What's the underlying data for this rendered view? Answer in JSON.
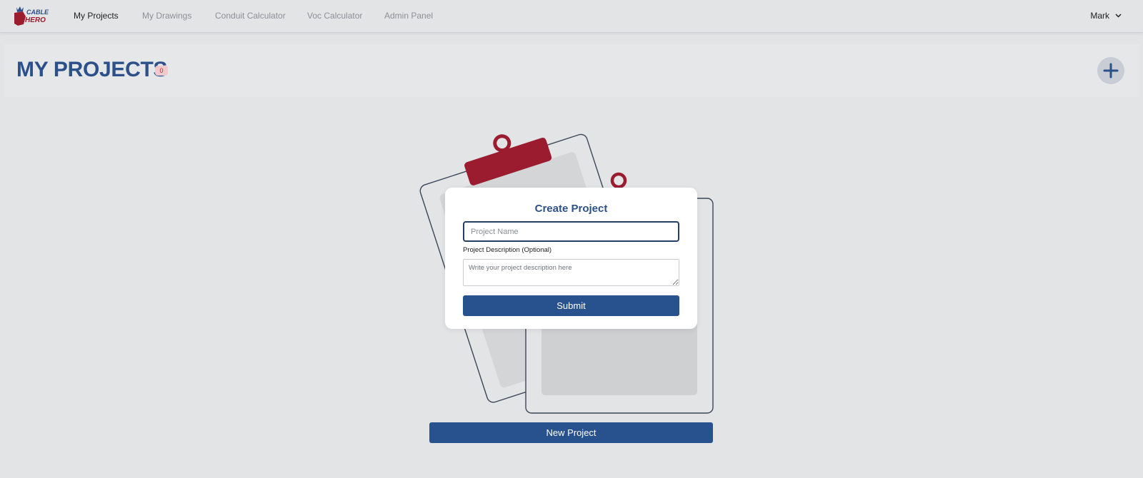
{
  "brand": {
    "logo_text_1": "CABLE",
    "logo_text_2": "HERO",
    "accent": "#9b1c2e",
    "primary": "#28528e"
  },
  "nav": {
    "items": [
      {
        "label": "My Projects",
        "active": true
      },
      {
        "label": "My Drawings",
        "active": false
      },
      {
        "label": "Conduit Calculator",
        "active": false
      },
      {
        "label": "Voc Calculator",
        "active": false
      },
      {
        "label": "Admin Panel",
        "active": false
      }
    ],
    "user": {
      "name": "Mark",
      "icon": "chevron-down-icon"
    }
  },
  "header": {
    "title": "MY PROJECTS",
    "count": "0",
    "add_icon": "plus-icon"
  },
  "modal": {
    "title": "Create Project",
    "name_placeholder": "Project Name",
    "name_value": "",
    "description_label": "Project Description (Optional)",
    "description_placeholder": "Write your project description here",
    "submit_label": "Submit"
  },
  "empty_state": {
    "illustration": "clipboard-illustration",
    "new_project_label": "New Project"
  }
}
